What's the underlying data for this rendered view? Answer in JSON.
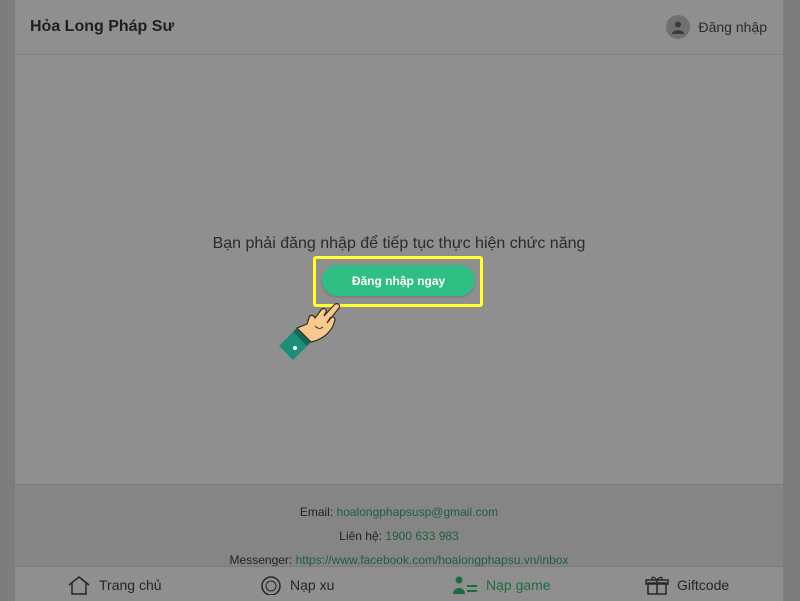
{
  "header": {
    "site_title": "Hỏa Long Pháp Sư",
    "login_label": "Đăng nhập"
  },
  "main": {
    "message": "Bạn phải đăng nhập để tiếp tục thực hiện chức năng",
    "cta_label": "Đăng nhập ngay"
  },
  "footer": {
    "email_label": "Email:",
    "email_value": "hoalongphapsusp@gmail.com",
    "phone_label": "Liên hệ:",
    "phone_value": "1900 633 983",
    "messenger_label": "Messenger:",
    "messenger_value": "https://www.facebook.com/hoalongphapsu.vn/inbox"
  },
  "nav": {
    "items": [
      {
        "label": "Trang chủ",
        "icon": "home-icon"
      },
      {
        "label": "Nạp xu",
        "icon": "coin-icon"
      },
      {
        "label": "Nạp game",
        "icon": "recharge-icon"
      },
      {
        "label": "Giftcode",
        "icon": "gift-icon"
      }
    ],
    "active_index": 2
  },
  "colors": {
    "accent": "#2fbe84",
    "highlight": "#ffff33"
  }
}
